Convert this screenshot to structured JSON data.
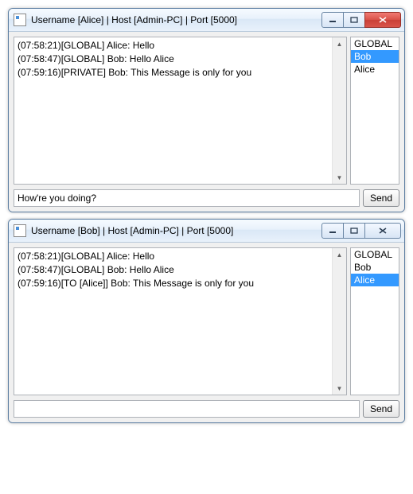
{
  "windows": [
    {
      "title": "Username [Alice] | Host [Admin-PC] | Port [5000]",
      "close_active": true,
      "messages": [
        "(07:58:21)[GLOBAL] Alice: Hello",
        "(07:58:47)[GLOBAL] Bob: Hello Alice",
        "(07:59:16)[PRIVATE] Bob: This Message is only for you"
      ],
      "users": [
        {
          "name": "GLOBAL",
          "selected": false
        },
        {
          "name": "Bob",
          "selected": true
        },
        {
          "name": "Alice",
          "selected": false
        }
      ],
      "input_value": "How're you doing?",
      "send_label": "Send"
    },
    {
      "title": "Username [Bob] | Host [Admin-PC] | Port [5000]",
      "close_active": false,
      "messages": [
        "(07:58:21)[GLOBAL] Alice: Hello",
        "(07:58:47)[GLOBAL] Bob: Hello Alice",
        "(07:59:16)[TO [Alice]] Bob: This Message is only for you"
      ],
      "users": [
        {
          "name": "GLOBAL",
          "selected": false
        },
        {
          "name": "Bob",
          "selected": false
        },
        {
          "name": "Alice",
          "selected": true
        }
      ],
      "input_value": "",
      "send_label": "Send"
    }
  ]
}
